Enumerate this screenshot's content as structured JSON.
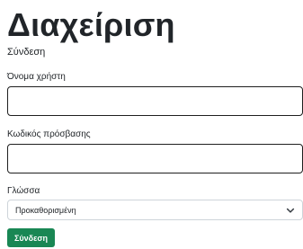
{
  "page": {
    "title": "Διαχείριση",
    "subtitle": "Σύνδεση"
  },
  "form": {
    "username_label": "Όνομα χρήστη",
    "username_value": "",
    "password_label": "Κωδικός πρόσβασης",
    "password_value": "",
    "language_label": "Γλώσσα",
    "language_selected": "Προκαθορισμένη",
    "submit_label": "Σύνδεση"
  },
  "icons": {
    "select_chevron": "chevron-down-icon"
  },
  "colors": {
    "submit_button": "#198754",
    "input_border": "#1f1f1f"
  }
}
